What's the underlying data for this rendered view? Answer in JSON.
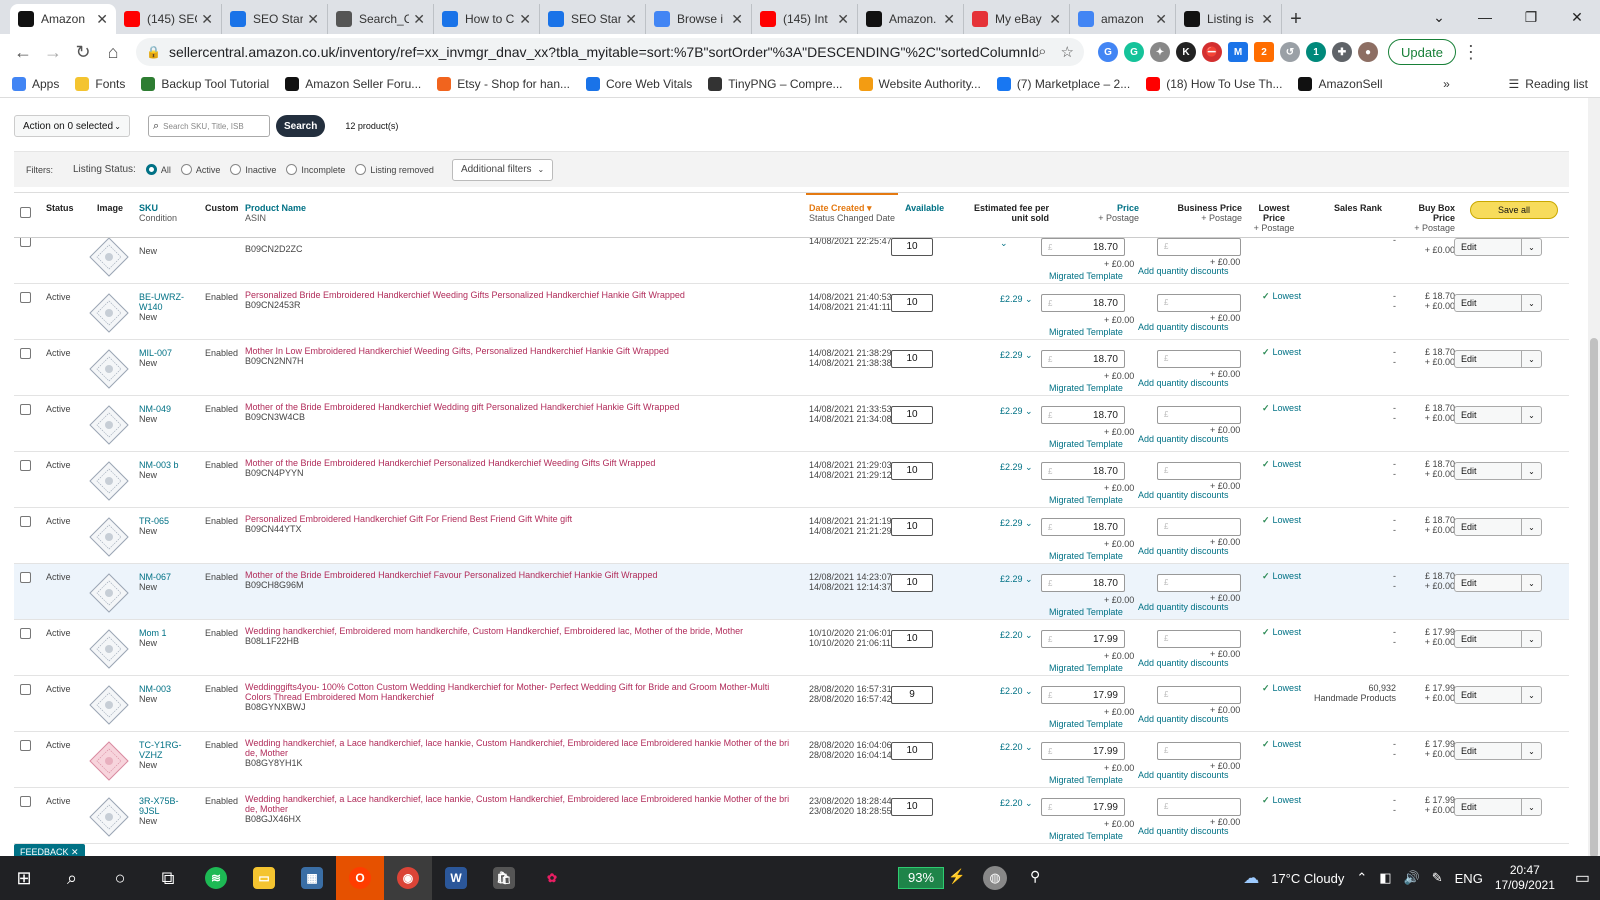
{
  "tabs": [
    {
      "label": "Amazon",
      "icon": "amazon-icon",
      "color": "#111111",
      "active": true
    },
    {
      "label": "(145) SEO",
      "icon": "youtube-icon",
      "color": "#ff0000"
    },
    {
      "label": "SEO Star",
      "icon": "code-icon",
      "color": "#1a73e8"
    },
    {
      "label": "Search_C",
      "icon": "globe-icon",
      "color": "#555555"
    },
    {
      "label": "How to C",
      "icon": "code-icon",
      "color": "#1a73e8"
    },
    {
      "label": "SEO Star",
      "icon": "code-icon",
      "color": "#1a73e8"
    },
    {
      "label": "Browse i",
      "icon": "google-icon",
      "color": "#4285f4"
    },
    {
      "label": "(145) Int",
      "icon": "youtube-icon",
      "color": "#ff0000"
    },
    {
      "label": "Amazon.",
      "icon": "amazon-icon",
      "color": "#111111"
    },
    {
      "label": "My eBay",
      "icon": "ebay-icon",
      "color": "#e53238"
    },
    {
      "label": "amazon",
      "icon": "google-icon",
      "color": "#4285f4"
    },
    {
      "label": "Listing is",
      "icon": "amazon-icon",
      "color": "#111111"
    }
  ],
  "url": "sellercentral.amazon.co.uk/inventory/ref=xx_invmgr_dnav_xx?tbla_myitable=sort:%7B\"sortOrder\"%3A\"DESCENDING\"%2C\"sortedColumnId\"%3A\"...",
  "update_label": "Update",
  "bookmarks": [
    {
      "label": "Apps",
      "icon": "apps-grid-icon",
      "color": "#4285f4"
    },
    {
      "label": "Fonts",
      "icon": "folder-icon",
      "color": "#f4c430"
    },
    {
      "label": "Backup Tool Tutorial",
      "icon": "bookmark-icon",
      "color": "#2e7d32"
    },
    {
      "label": "Amazon Seller Foru...",
      "icon": "amazon-icon",
      "color": "#111111"
    },
    {
      "label": "Etsy - Shop for han...",
      "icon": "etsy-icon",
      "color": "#f1641e"
    },
    {
      "label": "Core Web Vitals",
      "icon": "web-vitals-icon",
      "color": "#1a73e8"
    },
    {
      "label": "TinyPNG – Compre...",
      "icon": "panda-icon",
      "color": "#333333"
    },
    {
      "label": "Website Authority...",
      "icon": "authority-icon",
      "color": "#f39c12"
    },
    {
      "label": "(7) Marketplace – 2...",
      "icon": "facebook-icon",
      "color": "#1877f2"
    },
    {
      "label": "(18) How To Use Th...",
      "icon": "youtube-icon",
      "color": "#ff0000"
    },
    {
      "label": "AmazonSell",
      "icon": "amazon-icon",
      "color": "#111111"
    }
  ],
  "reading_list": "Reading list",
  "toolbar": {
    "action_label": "Action on 0 selected",
    "search_placeholder": "Search SKU, Title, ISB",
    "search_label": "Search",
    "count": "12 product(s)"
  },
  "filters": {
    "label": "Filters:",
    "status_label": "Listing Status:",
    "options": [
      "All",
      "Active",
      "Inactive",
      "Incomplete",
      "Listing removed"
    ],
    "additional": "Additional filters"
  },
  "columns": {
    "status": "Status",
    "image": "Image",
    "sku": "SKU",
    "sku_sub": "Condition",
    "custom": "Custom",
    "product": "Product Name",
    "product_sub": "ASIN",
    "date": "Date Created",
    "date_sub": "Status Changed Date",
    "available": "Available",
    "fee1": "Estimated fee per",
    "fee2": "unit sold",
    "price": "Price",
    "price_sub": "+ Postage",
    "biz": "Business Price",
    "biz_sub": "+ Postage",
    "low1": "Lowest",
    "low2": "Price",
    "low_sub": "+ Postage",
    "rank": "Sales Rank",
    "bb1": "Buy Box",
    "bb2": "Price",
    "bb_sub": "+ Postage",
    "save_all": "Save all"
  },
  "rows": [
    {
      "status": "",
      "sku": "",
      "cond": "New",
      "custom": "",
      "name": "",
      "asin": "B09CN2D2ZC",
      "d1": "14/08/2021 22:25:47",
      "d2": "",
      "qty": "10",
      "fee": "",
      "price": "18.70",
      "post": "+ £0.00",
      "tmpl": "Migrated Template",
      "biz": "+ £0.00",
      "disc": "Add quantity discounts",
      "lowest": "",
      "rank": "-",
      "rank2": "",
      "bb": "",
      "bbp": "+ £0.00",
      "edit": "Edit",
      "partial": true
    },
    {
      "status": "Active",
      "sku": "BE-UWRZ-W140",
      "cond": "New",
      "custom": "Enabled",
      "name": "Personalized Bride Embroidered Handkerchief Weeding Gifts Personalized Handkerchief Hankie Gift Wrapped",
      "asin": "B09CN2453R",
      "d1": "14/08/2021 21:40:53",
      "d2": "14/08/2021 21:41:11",
      "qty": "10",
      "fee": "£2.29",
      "price": "18.70",
      "post": "+ £0.00",
      "tmpl": "Migrated Template",
      "biz": "+ £0.00",
      "disc": "Add quantity discounts",
      "lowest": "Lowest",
      "rank": "-",
      "rank2": "-",
      "bb": "£ 18.70",
      "bbp": "+ £0.00",
      "edit": "Edit"
    },
    {
      "status": "Active",
      "sku": "MIL-007",
      "cond": "New",
      "custom": "Enabled",
      "name": "Mother In Low Embroidered Handkerchief Weeding Gifts, Personalized Handkerchief Hankie Gift Wrapped",
      "asin": "B09CN2NN7H",
      "d1": "14/08/2021 21:38:29",
      "d2": "14/08/2021 21:38:38",
      "qty": "10",
      "fee": "£2.29",
      "price": "18.70",
      "post": "+ £0.00",
      "tmpl": "Migrated Template",
      "biz": "+ £0.00",
      "disc": "Add quantity discounts",
      "lowest": "Lowest",
      "rank": "-",
      "rank2": "-",
      "bb": "£ 18.70",
      "bbp": "+ £0.00",
      "edit": "Edit"
    },
    {
      "status": "Active",
      "sku": "NM-049",
      "cond": "New",
      "custom": "Enabled",
      "name": "Mother of the Bride Embroidered Handkerchief Wedding gift Personalized Handkerchief Hankie Gift Wrapped",
      "asin": "B09CN3W4CB",
      "d1": "14/08/2021 21:33:53",
      "d2": "14/08/2021 21:34:08",
      "qty": "10",
      "fee": "£2.29",
      "price": "18.70",
      "post": "+ £0.00",
      "tmpl": "Migrated Template",
      "biz": "+ £0.00",
      "disc": "Add quantity discounts",
      "lowest": "Lowest",
      "rank": "-",
      "rank2": "-",
      "bb": "£ 18.70",
      "bbp": "+ £0.00",
      "edit": "Edit"
    },
    {
      "status": "Active",
      "sku": "NM-003 b",
      "cond": "New",
      "custom": "Enabled",
      "name": "Mother of the Bride Embroidered Handkerchief Personalized Handkerchief Weeding Gifts Gift Wrapped",
      "asin": "B09CN4PYYN",
      "d1": "14/08/2021 21:29:03",
      "d2": "14/08/2021 21:29:12",
      "qty": "10",
      "fee": "£2.29",
      "price": "18.70",
      "post": "+ £0.00",
      "tmpl": "Migrated Template",
      "biz": "+ £0.00",
      "disc": "Add quantity discounts",
      "lowest": "Lowest",
      "rank": "-",
      "rank2": "-",
      "bb": "£ 18.70",
      "bbp": "+ £0.00",
      "edit": "Edit"
    },
    {
      "status": "Active",
      "sku": "TR-065",
      "cond": "New",
      "custom": "Enabled",
      "name": "Personalized Embroidered Handkerchief Gift For Friend Best Friend Gift White gift",
      "asin": "B09CN44YTX",
      "d1": "14/08/2021 21:21:19",
      "d2": "14/08/2021 21:21:29",
      "qty": "10",
      "fee": "£2.29",
      "price": "18.70",
      "post": "+ £0.00",
      "tmpl": "Migrated Template",
      "biz": "+ £0.00",
      "disc": "Add quantity discounts",
      "lowest": "Lowest",
      "rank": "-",
      "rank2": "-",
      "bb": "£ 18.70",
      "bbp": "+ £0.00",
      "edit": "Edit"
    },
    {
      "status": "Active",
      "sku": "NM-067",
      "cond": "New",
      "custom": "Enabled",
      "name": "Mother of the Bride Embroidered Handkerchief Favour Personalized Handkerchief Hankie Gift Wrapped",
      "asin": "B09CH8G96M",
      "d1": "12/08/2021 14:23:07",
      "d2": "14/08/2021 12:14:37",
      "qty": "10",
      "fee": "£2.29",
      "price": "18.70",
      "post": "+ £0.00",
      "tmpl": "Migrated Template",
      "biz": "+ £0.00",
      "disc": "Add quantity discounts",
      "lowest": "Lowest",
      "rank": "-",
      "rank2": "-",
      "bb": "£ 18.70",
      "bbp": "+ £0.00",
      "edit": "Edit",
      "hl": true
    },
    {
      "status": "Active",
      "sku": "Mom 1",
      "cond": "New",
      "custom": "Enabled",
      "name": "Wedding handkerchief, Embroidered mom handkerchife, Custom Handkerchief, Embroidered lac, Mother of the bride, Mother",
      "asin": "B08L1F22HB",
      "d1": "10/10/2020 21:06:01",
      "d2": "10/10/2020 21:06:11",
      "qty": "10",
      "fee": "£2.20",
      "price": "17.99",
      "post": "+ £0.00",
      "tmpl": "Migrated Template",
      "biz": "+ £0.00",
      "disc": "Add quantity discounts",
      "lowest": "Lowest",
      "rank": "-",
      "rank2": "-",
      "bb": "£ 17.99",
      "bbp": "+ £0.00",
      "edit": "Edit"
    },
    {
      "status": "Active",
      "sku": "NM-003",
      "cond": "New",
      "custom": "Enabled",
      "name": "Weddinggifts4you- 100% Cotton Custom Wedding Handkerchief for Mother- Perfect Wedding Gift for Bride and Groom Mother-Multi Colors Thread Embroidered Mom Handkerchief",
      "asin": "B08GYNXBWJ",
      "d1": "28/08/2020 16:57:31",
      "d2": "28/08/2020 16:57:42",
      "qty": "9",
      "fee": "£2.20",
      "price": "17.99",
      "post": "+ £0.00",
      "tmpl": "Migrated Template",
      "biz": "+ £0.00",
      "disc": "Add quantity discounts",
      "lowest": "Lowest",
      "rank": "60,932",
      "rank2": "Handmade Products",
      "bb": "£ 17.99",
      "bbp": "+ £0.00",
      "edit": "Edit"
    },
    {
      "status": "Active",
      "sku": "TC-Y1RG-VZHZ",
      "cond": "New",
      "custom": "Enabled",
      "name": "Wedding handkerchief, a Lace handkerchief, lace hankie, Custom Handkerchief, Embroidered lace Embroidered hankie Mother of the bri de, Mother",
      "asin": "B08GY8YH1K",
      "d1": "28/08/2020 16:04:06",
      "d2": "28/08/2020 16:04:14",
      "qty": "10",
      "fee": "£2.20",
      "price": "17.99",
      "post": "+ £0.00",
      "tmpl": "Migrated Template",
      "biz": "+ £0.00",
      "disc": "Add quantity discounts",
      "lowest": "Lowest",
      "rank": "-",
      "rank2": "-",
      "bb": "£ 17.99",
      "bbp": "+ £0.00",
      "edit": "Edit",
      "pink": true
    },
    {
      "status": "Active",
      "sku": "3R-X75B-9JSL",
      "cond": "New",
      "custom": "Enabled",
      "name": "Wedding handkerchief, a Lace handkerchief, lace hankie, Custom Handkerchief, Embroidered lace Embroidered hankie Mother of the bri de, Mother",
      "asin": "B08GJX46HX",
      "d1": "23/08/2020 18:28:44",
      "d2": "23/08/2020 18:28:55",
      "qty": "10",
      "fee": "£2.20",
      "price": "17.99",
      "post": "+ £0.00",
      "tmpl": "Migrated Template",
      "biz": "+ £0.00",
      "disc": "Add quantity discounts",
      "lowest": "Lowest",
      "rank": "-",
      "rank2": "-",
      "bb": "£ 17.99",
      "bbp": "+ £0.00",
      "edit": "Edit"
    }
  ],
  "feedback": "FEEDBACK",
  "taskbar": {
    "battery": "93%",
    "weather": "17°C Cloudy",
    "lang": "ENG",
    "time": "20:47",
    "date": "17/09/2021"
  }
}
